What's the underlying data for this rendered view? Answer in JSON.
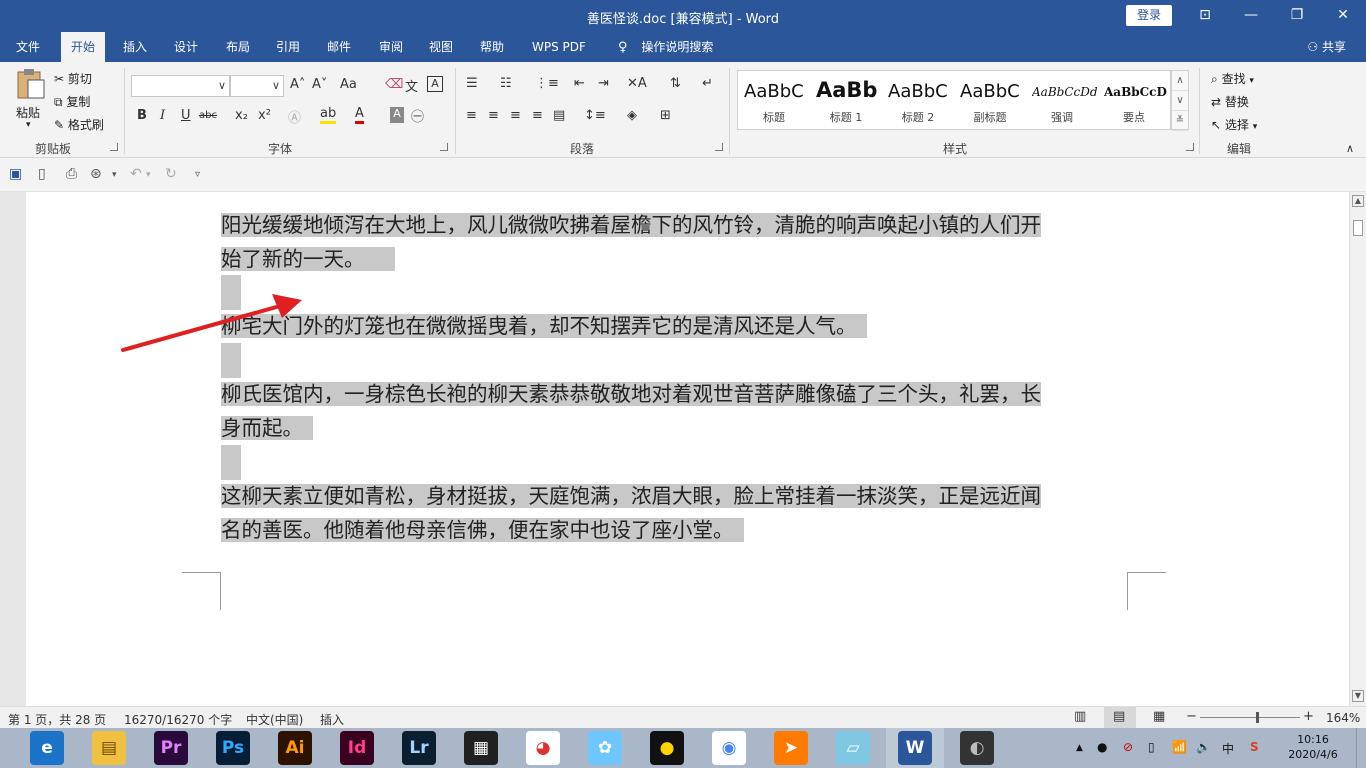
{
  "window": {
    "title": "善医怪谈.doc [兼容模式]  -  Word",
    "login": "登录",
    "min_glyph": "—",
    "restore_glyph": "❐",
    "close_glyph": "✕",
    "ribbon_display_glyph": "⊡"
  },
  "menu": {
    "tabs": [
      "文件",
      "开始",
      "插入",
      "设计",
      "布局",
      "引用",
      "邮件",
      "审阅",
      "视图",
      "帮助",
      "WPS PDF"
    ],
    "active_tab": "开始",
    "tell_me": "操作说明搜索",
    "share": "共享"
  },
  "ribbon": {
    "clipboard": {
      "paste": "粘贴",
      "cut": "剪切",
      "copy": "复制",
      "format_painter": "格式刷",
      "label": "剪贴板"
    },
    "font": {
      "font_name": "",
      "font_size": "",
      "bold": "B",
      "italic": "I",
      "underline": "U",
      "strikethrough": "abc",
      "subscript": "x₂",
      "superscript": "x²",
      "grow": "A˄",
      "shrink": "A˅",
      "change_case": "Aa",
      "label": "字体"
    },
    "paragraph": {
      "label": "段落"
    },
    "styles": {
      "items": [
        {
          "sample": "AaBbC",
          "name": "标题"
        },
        {
          "sample": "AaBb",
          "name": "标题 1"
        },
        {
          "sample": "AaBbC",
          "name": "标题 2"
        },
        {
          "sample": "AaBbC",
          "name": "副标题"
        },
        {
          "sample": "AaBbCcDd",
          "name": "强调"
        },
        {
          "sample": "AaBbCcD",
          "name": "要点"
        }
      ],
      "label": "样式"
    },
    "editing": {
      "find": "查找",
      "replace": "替换",
      "select": "选择",
      "label": "编辑"
    }
  },
  "document": {
    "paragraphs": [
      {
        "lines": [
          "阳光缓缓地倾泻在大地上，风儿微微吹拂着屋檐下的风竹铃，清脆的响声唤起小镇的人们开",
          "始了新的一天。"
        ]
      },
      {
        "lines": [
          "柳宅大门外的灯笼也在微微摇曳着，却不知摆弄它的是清风还是人气。"
        ]
      },
      {
        "lines": [
          "柳氏医馆内，一身棕色长袍的柳天素恭恭敬敬地对着观世音菩萨雕像磕了三个头，礼罢，长",
          "身而起。"
        ]
      },
      {
        "lines": [
          "这柳天素立便如青松，身材挺拔，天庭饱满，浓眉大眼，脸上常挂着一抹淡笑，正是远近闻",
          "名的善医。他随着他母亲信佛，便在家中也设了座小堂。"
        ]
      }
    ],
    "selection_color": "#c8c8c8",
    "arrow_color": "#e02020"
  },
  "status": {
    "page": "第 1 页，共 28 页",
    "words": "16270/16270 个字",
    "language": "中文(中国)",
    "mode": "插入",
    "zoom": "164%",
    "zoom_minus": "−",
    "zoom_plus": "+"
  },
  "taskbar": {
    "apps": [
      {
        "icon": "browser-icon",
        "glyph": "e",
        "color": "#1a73c6",
        "fg": "#ffffff"
      },
      {
        "icon": "file-explorer-icon",
        "glyph": "▤",
        "color": "#f0c040",
        "fg": "#6b4a00"
      },
      {
        "icon": "premiere-icon",
        "glyph": "Pr",
        "color": "#2a0a3a",
        "fg": "#e080ff"
      },
      {
        "icon": "photoshop-icon",
        "glyph": "Ps",
        "color": "#061e36",
        "fg": "#31a8ff"
      },
      {
        "icon": "illustrator-icon",
        "glyph": "Ai",
        "color": "#2e1200",
        "fg": "#ff9a00"
      },
      {
        "icon": "indesign-icon",
        "glyph": "Id",
        "color": "#3a0020",
        "fg": "#ff3d8a"
      },
      {
        "icon": "lightroom-icon",
        "glyph": "Lr",
        "color": "#0a2030",
        "fg": "#9fd4ff"
      },
      {
        "icon": "video-editor-icon",
        "glyph": "▦",
        "color": "#202020",
        "fg": "#ffffff"
      },
      {
        "icon": "colorful-app-icon",
        "glyph": "◕",
        "color": "#ffffff",
        "fg": "#e03030"
      },
      {
        "icon": "cute-app-icon",
        "glyph": "✿",
        "color": "#6ec6ff",
        "fg": "#ffffff"
      },
      {
        "icon": "qq-icon",
        "glyph": "●",
        "color": "#111111",
        "fg": "#ffd400"
      },
      {
        "icon": "chrome-icon",
        "glyph": "◉",
        "color": "#ffffff",
        "fg": "#4285f4"
      },
      {
        "icon": "orange-app-icon",
        "glyph": "➤",
        "color": "#ff7a00",
        "fg": "#ffffff"
      },
      {
        "icon": "notepad-app-icon",
        "glyph": "▱",
        "color": "#7ec8e3",
        "fg": "#ffffff"
      },
      {
        "icon": "word-icon",
        "glyph": "W",
        "color": "#2b579a",
        "fg": "#ffffff"
      },
      {
        "icon": "avatar-app-icon",
        "glyph": "◐",
        "color": "#333333",
        "fg": "#bbbbbb"
      }
    ],
    "tray": {
      "chevron": "▲",
      "ime": "中",
      "time": "10:16",
      "date": "2020/4/6"
    }
  }
}
